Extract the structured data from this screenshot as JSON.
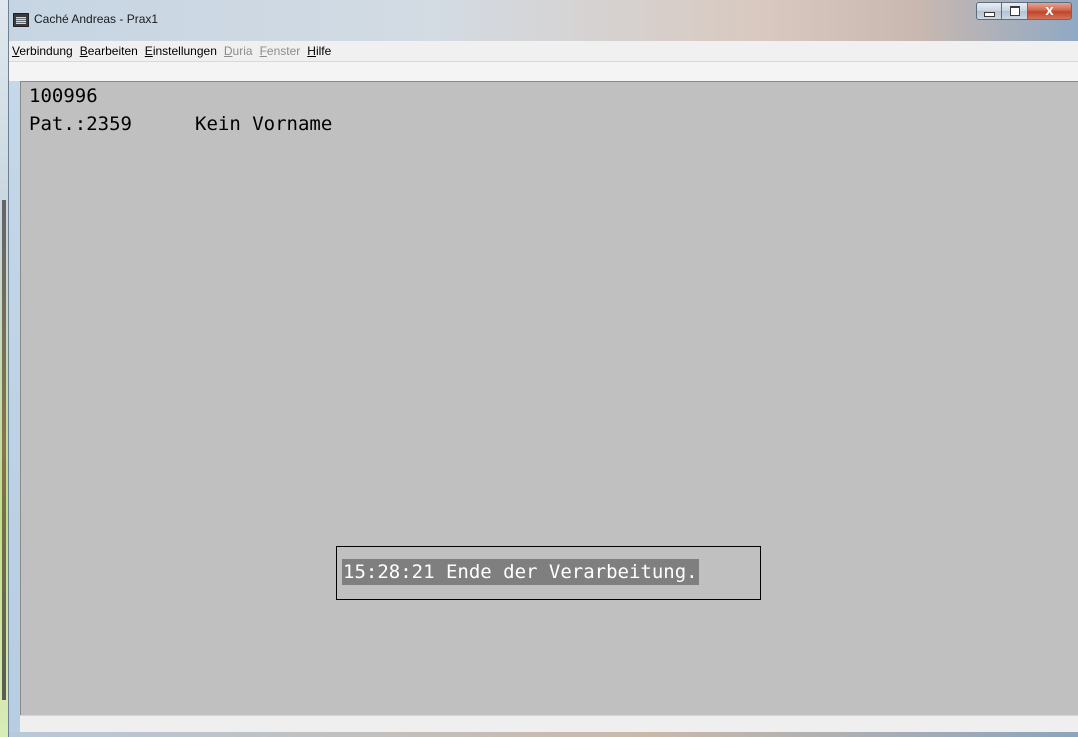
{
  "window": {
    "title": "Caché Andreas - Prax1",
    "buttons": {
      "close_label": "X"
    }
  },
  "menubar": {
    "items": [
      {
        "label": "Verbindung",
        "mnemonic": "V",
        "rest": "erbindung",
        "enabled": true
      },
      {
        "label": "Bearbeiten",
        "mnemonic": "B",
        "rest": "earbeiten",
        "enabled": true
      },
      {
        "label": "Einstellungen",
        "mnemonic": "E",
        "rest": "instellungen",
        "enabled": true
      },
      {
        "label": "Duria",
        "mnemonic": "D",
        "rest": "uria",
        "enabled": false
      },
      {
        "label": "Fenster",
        "mnemonic": "F",
        "rest": "enster",
        "enabled": false
      },
      {
        "label": "Hilfe",
        "mnemonic": "H",
        "rest": "ilfe",
        "enabled": true
      }
    ]
  },
  "terminal": {
    "line1": "100996",
    "patient_id": "Pat.:2359",
    "patient_name": "Kein Vorname",
    "message": "15:28:21 Ende der Verarbeitung."
  },
  "colors": {
    "terminal_background": "#c0c0c0",
    "highlight_background": "#7f7f7f",
    "highlight_text": "#ffffff"
  },
  "icons": [
    "terminal-app-icon",
    "minimize-icon",
    "maximize-icon",
    "close-icon"
  ]
}
